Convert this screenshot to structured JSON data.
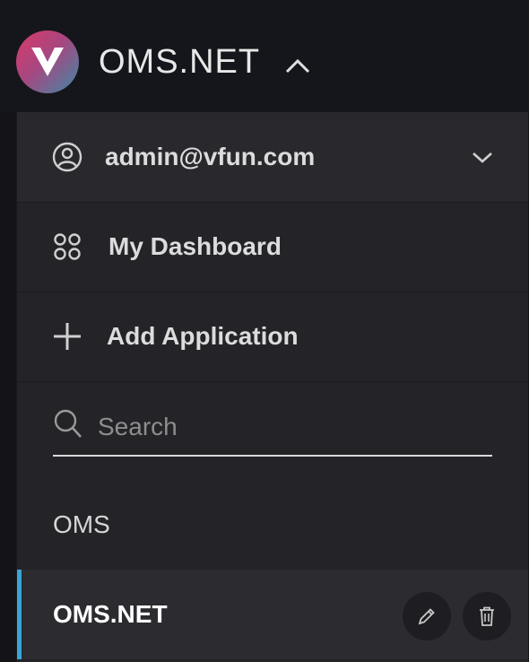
{
  "header": {
    "app_title": "OMS.NET",
    "logo_icon": "v-logo-icon",
    "toggle_icon": "chevron-up-icon"
  },
  "menu": {
    "user": {
      "label": "admin@vfun.com",
      "icon": "user-circle-icon",
      "expand_icon": "chevron-down-icon"
    },
    "dashboard": {
      "label": "My Dashboard",
      "icon": "grid-icon"
    },
    "add_app": {
      "label": "Add Application",
      "icon": "plus-icon"
    },
    "search": {
      "placeholder": "Search",
      "value": "",
      "icon": "search-icon"
    }
  },
  "applications": [
    {
      "name": "OMS",
      "selected": false
    },
    {
      "name": "OMS.NET",
      "selected": true
    }
  ],
  "colors": {
    "accent": "#3aa5d8",
    "panel_bg": "#242428",
    "selected_bg": "#2b2b30"
  }
}
